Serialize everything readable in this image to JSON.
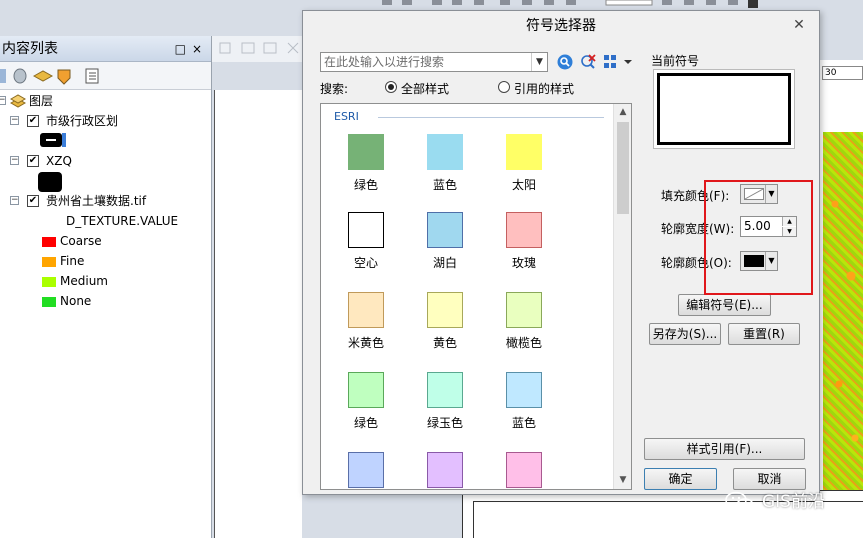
{
  "toc": {
    "title": "内容列表",
    "root_layer": "图层",
    "layers": [
      {
        "name": "市级行政区划",
        "checked": true
      },
      {
        "name": "XZQ",
        "checked": true
      },
      {
        "name": "贵州省土壤数据.tif",
        "checked": true,
        "field": "D_TEXTURE.VALUE",
        "legend": [
          {
            "label": "Coarse",
            "color": "#ff0000"
          },
          {
            "label": "Fine",
            "color": "#ffa500"
          },
          {
            "label": "Medium",
            "color": "#aaff00"
          },
          {
            "label": "None",
            "color": "#22dd22"
          }
        ]
      }
    ]
  },
  "map": {
    "coord_label": "30"
  },
  "dialog": {
    "title": "符号选择器",
    "search_placeholder": "在此处输入以进行搜索",
    "search_label": "搜索:",
    "radio_all": "全部样式",
    "radio_referenced": "引用的样式",
    "radio_selected": "all",
    "gallery_group": "ESRI",
    "symbols": [
      {
        "label": "绿色",
        "fill": "#76b276",
        "stroke": "#76b276"
      },
      {
        "label": "蓝色",
        "fill": "#9adcf0",
        "stroke": "#9adcf0"
      },
      {
        "label": "太阳",
        "fill": "#ffff66",
        "stroke": "#ffff66"
      },
      {
        "label": "空心",
        "fill": "#ffffff",
        "stroke": "#000000"
      },
      {
        "label": "湖白",
        "fill": "#a0d8ef",
        "stroke": "#4f6fa8"
      },
      {
        "label": "玫瑰",
        "fill": "#ffbfbf",
        "stroke": "#c46060"
      },
      {
        "label": "米黄色",
        "fill": "#ffe8bf",
        "stroke": "#c09a5a"
      },
      {
        "label": "黄色",
        "fill": "#ffffbf",
        "stroke": "#a8a85a"
      },
      {
        "label": "橄榄色",
        "fill": "#e9ffbf",
        "stroke": "#8aa85a"
      },
      {
        "label": "绿色",
        "fill": "#bfffbf",
        "stroke": "#5aa85a"
      },
      {
        "label": "绿玉色",
        "fill": "#bfffe8",
        "stroke": "#5aa890"
      },
      {
        "label": "蓝色",
        "fill": "#bfe8ff",
        "stroke": "#5a90a8"
      },
      {
        "label": "",
        "fill": "#bfd3ff",
        "stroke": "#5a6fa8"
      },
      {
        "label": "",
        "fill": "#e3bfff",
        "stroke": "#8a5aa8"
      },
      {
        "label": "",
        "fill": "#ffbfe8",
        "stroke": "#a85a90"
      }
    ],
    "current_symbol_label": "当前符号",
    "fill_color_label": "填充颜色(F):",
    "outline_width_label": "轮廓宽度(W):",
    "outline_width_value": "5.00",
    "outline_color_label": "轮廓颜色(O):",
    "outline_color": "#000000",
    "edit_symbol_button": "编辑符号(E)...",
    "save_as_button": "另存为(S)...",
    "reset_button": "重置(R)",
    "style_references_button": "样式引用(F)...",
    "ok_button": "确定",
    "cancel_button": "取消"
  },
  "watermark": {
    "text": "GIS前沿"
  },
  "colors": {
    "highlight_box": "#e0171b",
    "esri_header": "#1e5aa8"
  }
}
